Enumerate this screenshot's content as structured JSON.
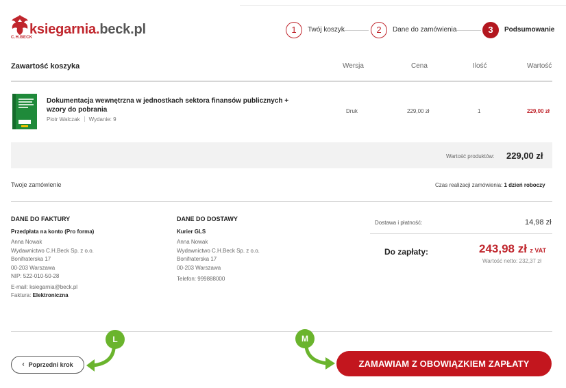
{
  "logo": {
    "brand_red": "ksiegarnia.",
    "brand_grey": "beck.pl",
    "sub": "C.H.BECK",
    "accent": "#c0262d"
  },
  "steps": [
    {
      "number": "1",
      "label": "Twój koszyk",
      "active": false
    },
    {
      "number": "2",
      "label": "Dane do zamówienia",
      "active": false
    },
    {
      "number": "3",
      "label": "Podsumowanie",
      "active": true
    }
  ],
  "cart": {
    "title": "Zawartość koszyka",
    "headers": {
      "version": "Wersja",
      "price": "Cena",
      "qty": "Ilość",
      "value": "Wartość"
    },
    "items": [
      {
        "title": "Dokumentacja wewnętrzna w jednostkach sektora finansów publicznych + wzory do pobrania",
        "author": "Piotr Walczak",
        "edition": "Wydanie: 9",
        "version": "Druk",
        "price": "229,00 zł",
        "qty": "1",
        "value": "229,00 zł"
      }
    ],
    "products_value_label": "Wartość produktów:",
    "products_value": "229,00 zł"
  },
  "order": {
    "title": "Twoje zamówienie",
    "time_label": "Czas realizacji zamówienia:",
    "time_value": "1 dzień roboczy"
  },
  "invoice": {
    "heading": "DANE DO FAKTURY",
    "payment": "Przedpłata na konto (Pro forma)",
    "lines": [
      "Anna Nowak",
      "Wydawnictwo C.H.Beck Sp. z o.o.",
      "Bonifraterska 17",
      "00-203 Warszawa",
      "NIP: 522-010-50-28"
    ],
    "email": "E-mail: ksiegarnia@beck.pl",
    "invoice_label": "Faktura:",
    "invoice_value": "Elektroniczna"
  },
  "delivery": {
    "heading": "DANE DO DOSTAWY",
    "carrier": "Kurier GLS",
    "lines": [
      "Anna Nowak",
      "Wydawnictwo C.H.Beck Sp. z o.o.",
      "Bonifraterska 17",
      "00-203 Warszawa"
    ],
    "phone": "Telefon: 999888000"
  },
  "totals": {
    "shipping_label": "Dostawa i płatność:",
    "shipping_value": "14,98 zł",
    "to_pay_label": "Do zapłaty:",
    "to_pay_value": "243,98 zł",
    "vat_suffix": "z VAT",
    "net": "Wartość netto: 232,37 zł"
  },
  "buttons": {
    "prev": "Poprzedni krok",
    "order": "ZAMAWIAM Z OBOWIĄZKIEM ZAPŁATY"
  },
  "annotations": {
    "l": "L",
    "m": "M",
    "color": "#6ab42d"
  }
}
